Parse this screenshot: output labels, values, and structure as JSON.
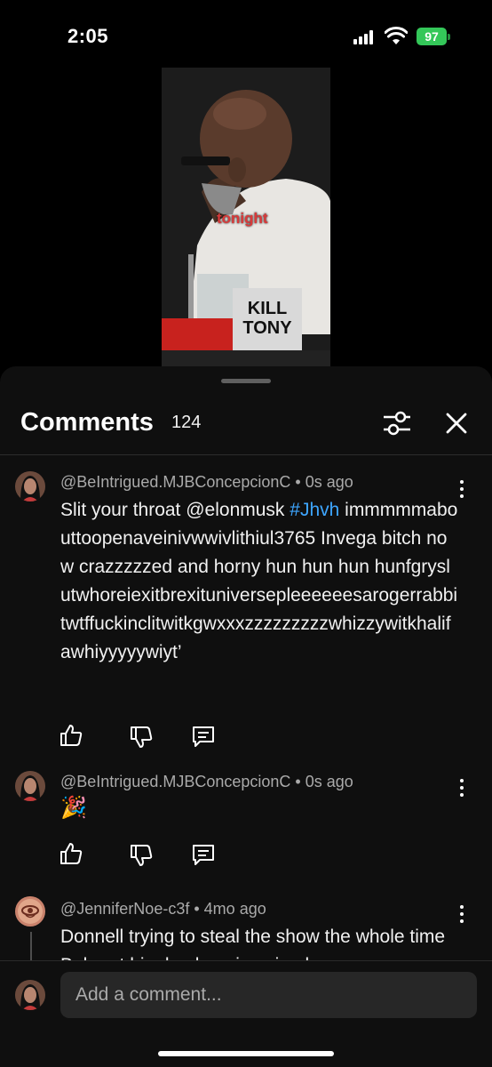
{
  "status_bar": {
    "time": "2:05",
    "battery": "97"
  },
  "video": {
    "caption": "tonight",
    "logo_line1": "KILL",
    "logo_line2": "TONY"
  },
  "comments_panel": {
    "title": "Comments",
    "count": "124",
    "filter_icon": "sliders-icon",
    "close_icon": "close-icon"
  },
  "comments": [
    {
      "author": "@BeIntrigued.MJBConcepcionC",
      "time": "0s ago",
      "text_before": "Slit your throat @elonmusk ",
      "hashtag": "#Jhvh",
      "text_after": " immmmmabouttoopenaveinivwwivlithiul3765 Invega bitch now crazzzzzed and horny hun hun hun hunfgryslutwhoreiexitbrexituniversepleeeeeesarogerrabbitwtffuckinclitwitkgwxxxzzzzzzzzzwhizzywitkhalifawhiyyyyywiyt’"
    },
    {
      "author": "@BeIntrigued.MJBConcepcionC",
      "time": "0s ago",
      "emoji": "🎉"
    },
    {
      "author": "@JenniferNoe-c3f",
      "time": "4mo ago",
      "text": "Donnell trying to steal the show the whole time Bob got him back, epic episode"
    }
  ],
  "composer": {
    "placeholder": "Add a comment..."
  }
}
